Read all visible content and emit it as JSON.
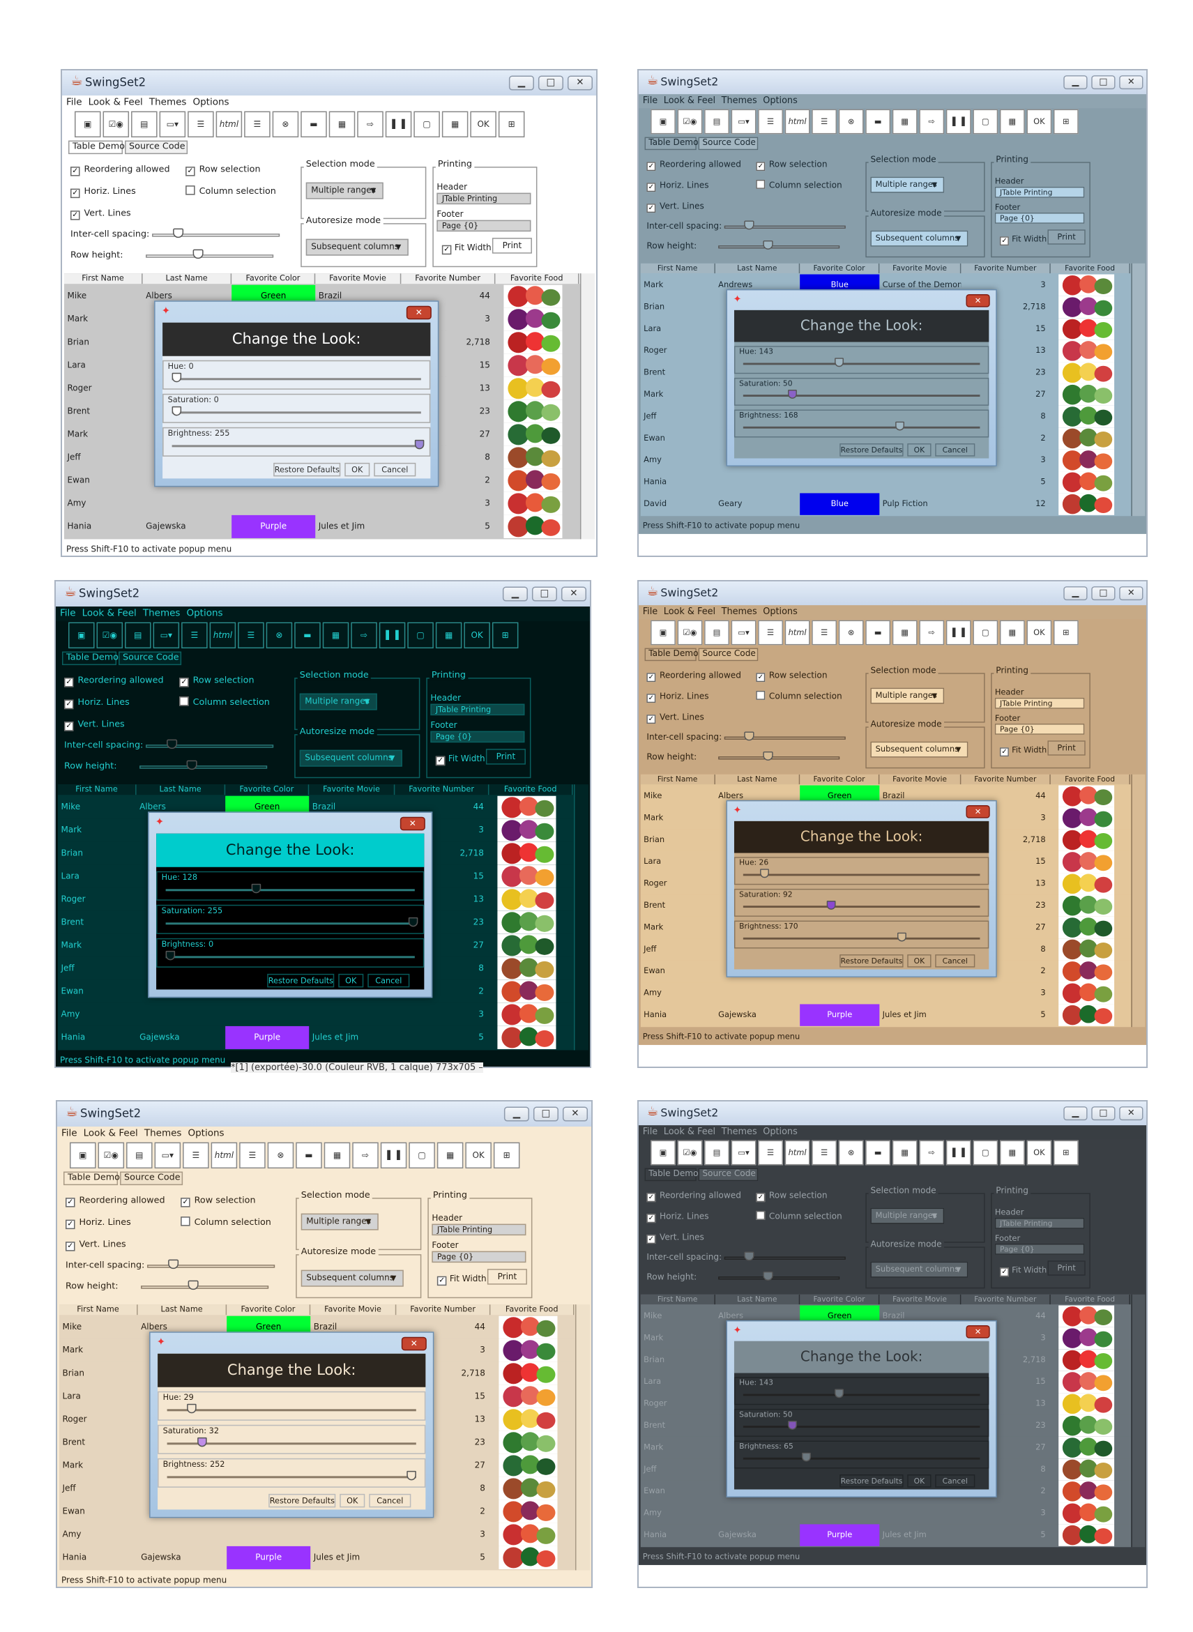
{
  "app": {
    "title": "SwingSet2",
    "window_buttons": [
      "▁",
      "□",
      "✕"
    ],
    "menus": [
      "File",
      "Look & Feel",
      "Themes",
      "Options"
    ],
    "tabs": [
      "Table Demo",
      "Source Code"
    ],
    "status_text": "Press Shift-F10 to activate popup menu"
  },
  "toolbar": {
    "icons": [
      "internal-frame-icon",
      "checkbox-radio-icon",
      "color-chooser-icon",
      "combobox-icon",
      "file-chooser-icon",
      "html-icon",
      "list-icon",
      "option-pane-icon",
      "progress-bar-icon",
      "scroll-pane-icon",
      "slider-icon",
      "split-pane-icon",
      "tabbed-pane-icon",
      "table-icon",
      "tooltip-icon",
      "tree-icon"
    ],
    "html_label": "html"
  },
  "controls": {
    "reordering_allowed": "Reordering allowed",
    "row_selection": "Row selection",
    "horiz_lines": "Horiz. Lines",
    "column_selection": "Column selection",
    "vert_lines": "Vert. Lines",
    "inter_cell_spacing": "Inter-cell spacing:",
    "row_height": "Row height:",
    "selection_mode_label": "Selection mode",
    "selection_mode_value": "Multiple ranges",
    "autoresize_label": "Autoresize mode",
    "autoresize_value": "Subsequent columns",
    "printing_label": "Printing",
    "header_label": "Header",
    "header_value": "JTable Printing",
    "footer_label": "Footer",
    "footer_value": "Page {0}",
    "fit_width": "Fit Width",
    "print": "Print"
  },
  "table": {
    "columns": [
      "First Name",
      "Last Name",
      "Favorite Color",
      "Favorite Movie",
      "Favorite Number",
      "Favorite Food"
    ]
  },
  "dialog": {
    "banner": "Change the Look:",
    "hue_prefix": "Hue: ",
    "saturation_prefix": "Saturation: ",
    "brightness_prefix": "Brightness: ",
    "restore_defaults": "Restore Defaults",
    "ok": "OK",
    "cancel": "Cancel"
  },
  "screens": [
    {
      "theme": "default",
      "hue": "0",
      "saturation": "0",
      "brightness": "255",
      "hue_value": 0,
      "saturation_value": 0,
      "brightness_value": 255,
      "rows": [
        {
          "first": "Mike",
          "last": "Albers",
          "color": "Green",
          "movie": "Brazil",
          "number": "44"
        },
        {
          "first": "Mark",
          "last": "",
          "color": "",
          "movie": "",
          "number": "3"
        },
        {
          "first": "Brian",
          "last": "",
          "color": "",
          "movie": "",
          "number": "2,718"
        },
        {
          "first": "Lara",
          "last": "",
          "color": "",
          "movie": "",
          "number": "15"
        },
        {
          "first": "Roger",
          "last": "",
          "color": "",
          "movie": "",
          "number": "13"
        },
        {
          "first": "Brent",
          "last": "",
          "color": "",
          "movie": "",
          "number": "23"
        },
        {
          "first": "Mark",
          "last": "",
          "color": "",
          "movie": "",
          "number": "27"
        },
        {
          "first": "Jeff",
          "last": "",
          "color": "",
          "movie": "",
          "number": "8"
        },
        {
          "first": "Ewan",
          "last": "",
          "color": "",
          "movie": "",
          "number": "2"
        },
        {
          "first": "Amy",
          "last": "",
          "color": "",
          "movie": "",
          "number": "3"
        },
        {
          "first": "Hania",
          "last": "Gajewska",
          "color": "Purple",
          "movie": "Jules et Jim",
          "number": "5"
        }
      ]
    },
    {
      "theme": "steel-blue",
      "hue": "143",
      "saturation": "50",
      "brightness": "168",
      "hue_value": 143,
      "saturation_value": 50,
      "brightness_value": 168,
      "rows": [
        {
          "first": "Mark",
          "last": "Andrews",
          "color": "Blue",
          "movie": "Curse of the Demon",
          "number": "3"
        },
        {
          "first": "Brian",
          "last": "",
          "color": "",
          "movie": "",
          "number": "2,718"
        },
        {
          "first": "Lara",
          "last": "",
          "color": "",
          "movie": "",
          "number": "15"
        },
        {
          "first": "Roger",
          "last": "",
          "color": "",
          "movie": "",
          "number": "13"
        },
        {
          "first": "Brent",
          "last": "",
          "color": "",
          "movie": "",
          "number": "23"
        },
        {
          "first": "Mark",
          "last": "",
          "color": "",
          "movie": "",
          "number": "27"
        },
        {
          "first": "Jeff",
          "last": "",
          "color": "",
          "movie": "",
          "number": "8"
        },
        {
          "first": "Ewan",
          "last": "",
          "color": "",
          "movie": "",
          "number": "2"
        },
        {
          "first": "Amy",
          "last": "",
          "color": "",
          "movie": "",
          "number": "3"
        },
        {
          "first": "Hania",
          "last": "",
          "color": "",
          "movie": "",
          "number": "5"
        },
        {
          "first": "David",
          "last": "Geary",
          "color": "Blue",
          "movie": "Pulp Fiction",
          "number": "12"
        }
      ]
    },
    {
      "theme": "dark-cyan",
      "hue": "128",
      "saturation": "255",
      "brightness": "0",
      "hue_value": 128,
      "saturation_value": 255,
      "brightness_value": 0,
      "overlay_text": "*[1] (exportée)-30.0 (Couleur RVB, 1 calque) 773x705 –",
      "rows": [
        {
          "first": "Mike",
          "last": "Albers",
          "color": "Green",
          "movie": "Brazil",
          "number": "44"
        },
        {
          "first": "Mark",
          "last": "",
          "color": "",
          "movie": "",
          "number": "3"
        },
        {
          "first": "Brian",
          "last": "",
          "color": "",
          "movie": "",
          "number": "2,718"
        },
        {
          "first": "Lara",
          "last": "",
          "color": "",
          "movie": "",
          "number": "15"
        },
        {
          "first": "Roger",
          "last": "",
          "color": "",
          "movie": "",
          "number": "13"
        },
        {
          "first": "Brent",
          "last": "",
          "color": "",
          "movie": "",
          "number": "23"
        },
        {
          "first": "Mark",
          "last": "",
          "color": "",
          "movie": "",
          "number": "27"
        },
        {
          "first": "Jeff",
          "last": "",
          "color": "",
          "movie": "",
          "number": "8"
        },
        {
          "first": "Ewan",
          "last": "",
          "color": "",
          "movie": "",
          "number": "2"
        },
        {
          "first": "Amy",
          "last": "",
          "color": "",
          "movie": "",
          "number": "3"
        },
        {
          "first": "Hania",
          "last": "Gajewska",
          "color": "Purple",
          "movie": "Jules et Jim",
          "number": "5"
        }
      ]
    },
    {
      "theme": "tan",
      "hue": "26",
      "saturation": "92",
      "brightness": "170",
      "hue_value": 26,
      "saturation_value": 92,
      "brightness_value": 170,
      "rows": [
        {
          "first": "Mike",
          "last": "Albers",
          "color": "Green",
          "movie": "Brazil",
          "number": "44"
        },
        {
          "first": "Mark",
          "last": "",
          "color": "",
          "movie": "",
          "number": "3"
        },
        {
          "first": "Brian",
          "last": "",
          "color": "",
          "movie": "",
          "number": "2,718"
        },
        {
          "first": "Lara",
          "last": "",
          "color": "",
          "movie": "",
          "number": "15"
        },
        {
          "first": "Roger",
          "last": "",
          "color": "",
          "movie": "",
          "number": "13"
        },
        {
          "first": "Brent",
          "last": "",
          "color": "",
          "movie": "",
          "number": "23"
        },
        {
          "first": "Mark",
          "last": "",
          "color": "",
          "movie": "",
          "number": "27"
        },
        {
          "first": "Jeff",
          "last": "",
          "color": "",
          "movie": "",
          "number": "8"
        },
        {
          "first": "Ewan",
          "last": "",
          "color": "",
          "movie": "",
          "number": "2"
        },
        {
          "first": "Amy",
          "last": "",
          "color": "",
          "movie": "",
          "number": "3"
        },
        {
          "first": "Hania",
          "last": "Gajewska",
          "color": "Purple",
          "movie": "Jules et Jim",
          "number": "5"
        }
      ]
    },
    {
      "theme": "cream",
      "hue": "29",
      "saturation": "32",
      "brightness": "252",
      "hue_value": 29,
      "saturation_value": 32,
      "brightness_value": 252,
      "rows": [
        {
          "first": "Mike",
          "last": "Albers",
          "color": "Green",
          "movie": "Brazil",
          "number": "44"
        },
        {
          "first": "Mark",
          "last": "",
          "color": "",
          "movie": "",
          "number": "3"
        },
        {
          "first": "Brian",
          "last": "",
          "color": "",
          "movie": "",
          "number": "2,718"
        },
        {
          "first": "Lara",
          "last": "",
          "color": "",
          "movie": "",
          "number": "15"
        },
        {
          "first": "Roger",
          "last": "",
          "color": "",
          "movie": "",
          "number": "13"
        },
        {
          "first": "Brent",
          "last": "",
          "color": "",
          "movie": "",
          "number": "23"
        },
        {
          "first": "Mark",
          "last": "",
          "color": "",
          "movie": "",
          "number": "27"
        },
        {
          "first": "Jeff",
          "last": "",
          "color": "",
          "movie": "",
          "number": "8"
        },
        {
          "first": "Ewan",
          "last": "",
          "color": "",
          "movie": "",
          "number": "2"
        },
        {
          "first": "Amy",
          "last": "",
          "color": "",
          "movie": "",
          "number": "3"
        },
        {
          "first": "Hania",
          "last": "Gajewska",
          "color": "Purple",
          "movie": "Jules et Jim",
          "number": "5"
        }
      ]
    },
    {
      "theme": "dark-slate",
      "hue": "143",
      "saturation": "50",
      "brightness": "65",
      "hue_value": 143,
      "saturation_value": 50,
      "brightness_value": 65,
      "rows": [
        {
          "first": "Mike",
          "last": "Albers",
          "color": "Green",
          "movie": "Brazil",
          "number": "44"
        },
        {
          "first": "Mark",
          "last": "",
          "color": "",
          "movie": "",
          "number": "3"
        },
        {
          "first": "Brian",
          "last": "",
          "color": "",
          "movie": "",
          "number": "2,718"
        },
        {
          "first": "Lara",
          "last": "",
          "color": "",
          "movie": "",
          "number": "15"
        },
        {
          "first": "Roger",
          "last": "",
          "color": "",
          "movie": "",
          "number": "13"
        },
        {
          "first": "Brent",
          "last": "",
          "color": "",
          "movie": "",
          "number": "23"
        },
        {
          "first": "Mark",
          "last": "",
          "color": "",
          "movie": "",
          "number": "27"
        },
        {
          "first": "Jeff",
          "last": "",
          "color": "",
          "movie": "",
          "number": "8"
        },
        {
          "first": "Ewan",
          "last": "",
          "color": "",
          "movie": "",
          "number": "2"
        },
        {
          "first": "Amy",
          "last": "",
          "color": "",
          "movie": "",
          "number": "3"
        },
        {
          "first": "Hania",
          "last": "Gajewska",
          "color": "Purple",
          "movie": "Jules et Jim",
          "number": "5"
        }
      ]
    }
  ],
  "colors": {
    "green": "#00ff33",
    "blue": "#0000ee",
    "purple": "#9933ff"
  }
}
